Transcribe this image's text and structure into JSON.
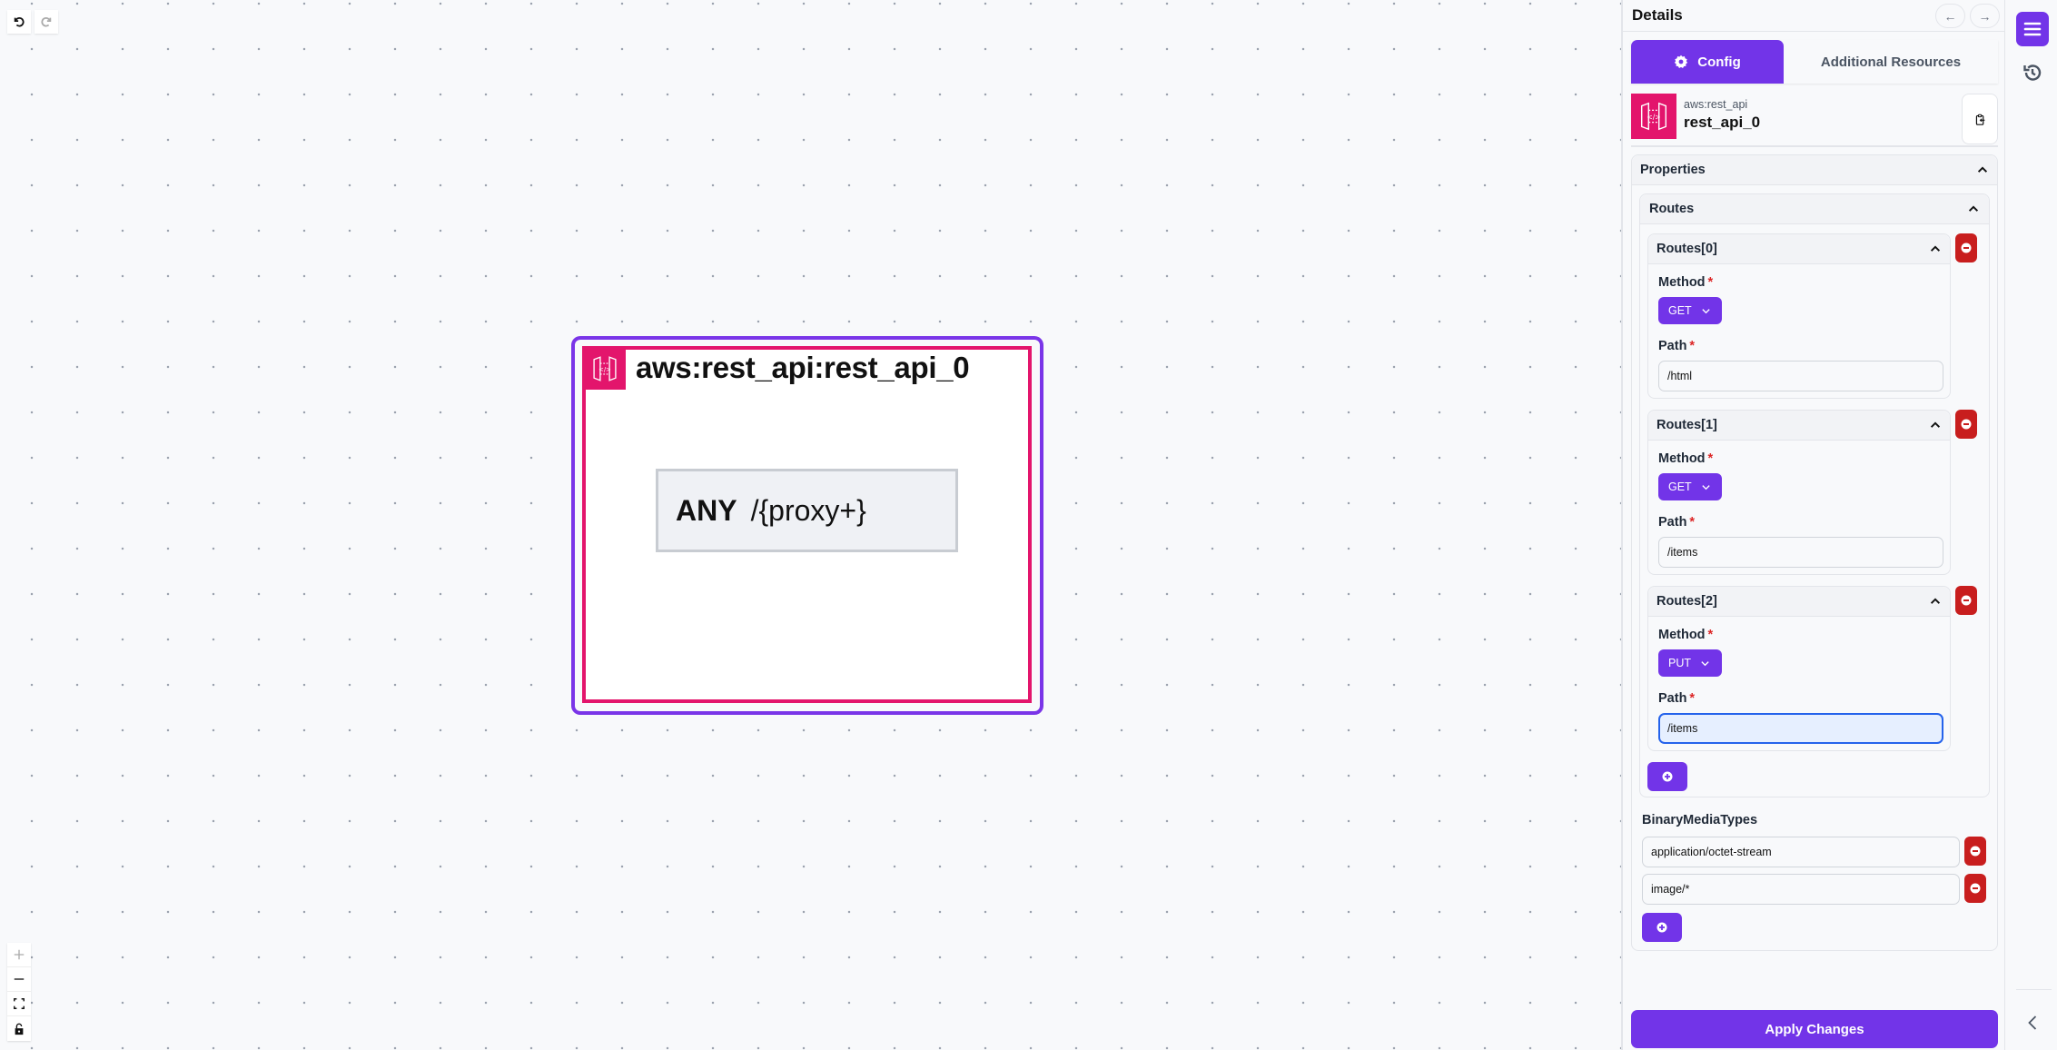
{
  "canvas": {
    "toolbar": {
      "undo_label": "Undo",
      "redo_label": "Redo"
    },
    "zoom_controls": [
      "zoom-in",
      "zoom-out",
      "fit-view",
      "toggle-interactivity"
    ],
    "node": {
      "title": "aws:rest_api:rest_api_0",
      "icon": "api-gateway-icon",
      "route": {
        "method": "ANY",
        "path": "/{proxy+}"
      }
    }
  },
  "panel": {
    "title": "Details",
    "nav": {
      "back": "←",
      "forward": "→"
    },
    "tabs": [
      {
        "label": "Config",
        "icon": "gear-icon",
        "active": true
      },
      {
        "label": "Additional Resources",
        "active": false
      }
    ],
    "resource": {
      "type": "aws:rest_api",
      "name": "rest_api_0",
      "icon": "api-gateway-icon"
    },
    "properties": {
      "title": "Properties",
      "routes": {
        "title": "Routes",
        "items": [
          {
            "title": "Routes[0]",
            "method_label": "Method",
            "method": "GET",
            "path_label": "Path",
            "path": "/html"
          },
          {
            "title": "Routes[1]",
            "method_label": "Method",
            "method": "GET",
            "path_label": "Path",
            "path": "/items"
          },
          {
            "title": "Routes[2]",
            "method_label": "Method",
            "method": "PUT",
            "path_label": "Path",
            "path": "/items",
            "focused": true
          }
        ]
      },
      "binary_media_types": {
        "title": "BinaryMediaTypes",
        "items": [
          "application/octet-stream",
          "image/*"
        ]
      }
    },
    "required_marker": "*",
    "apply_label": "Apply Changes"
  },
  "colors": {
    "accent": "#7234e8",
    "resource_pink": "#e3156c",
    "danger": "#c81e1e",
    "focus": "#2563eb"
  }
}
